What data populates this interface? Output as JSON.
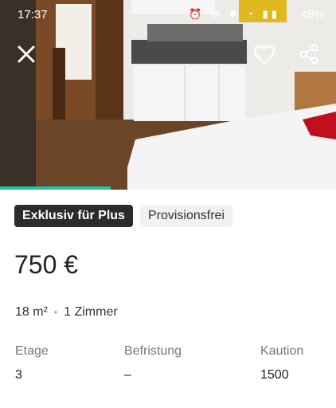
{
  "status_bar": {
    "time": "17:37",
    "icons": "⏰ ✉ ✱ ◔ ▮▮",
    "battery": "48%"
  },
  "photo": {
    "gallery_progress": 0.33
  },
  "actions": {
    "close_icon": "close-icon",
    "favorite_icon": "heart-icon",
    "share_icon": "share-icon"
  },
  "badges": {
    "plus": "Exklusiv für Plus",
    "provision": "Provisionsfrei"
  },
  "price": "750 €",
  "specs": {
    "area": "18 m²",
    "separator": "•",
    "rooms": "1 Zimmer"
  },
  "attributes": [
    {
      "label": "Etage",
      "value": "3"
    },
    {
      "label": "Befristung",
      "value": "–"
    },
    {
      "label": "Kaution",
      "value": "1500"
    }
  ]
}
